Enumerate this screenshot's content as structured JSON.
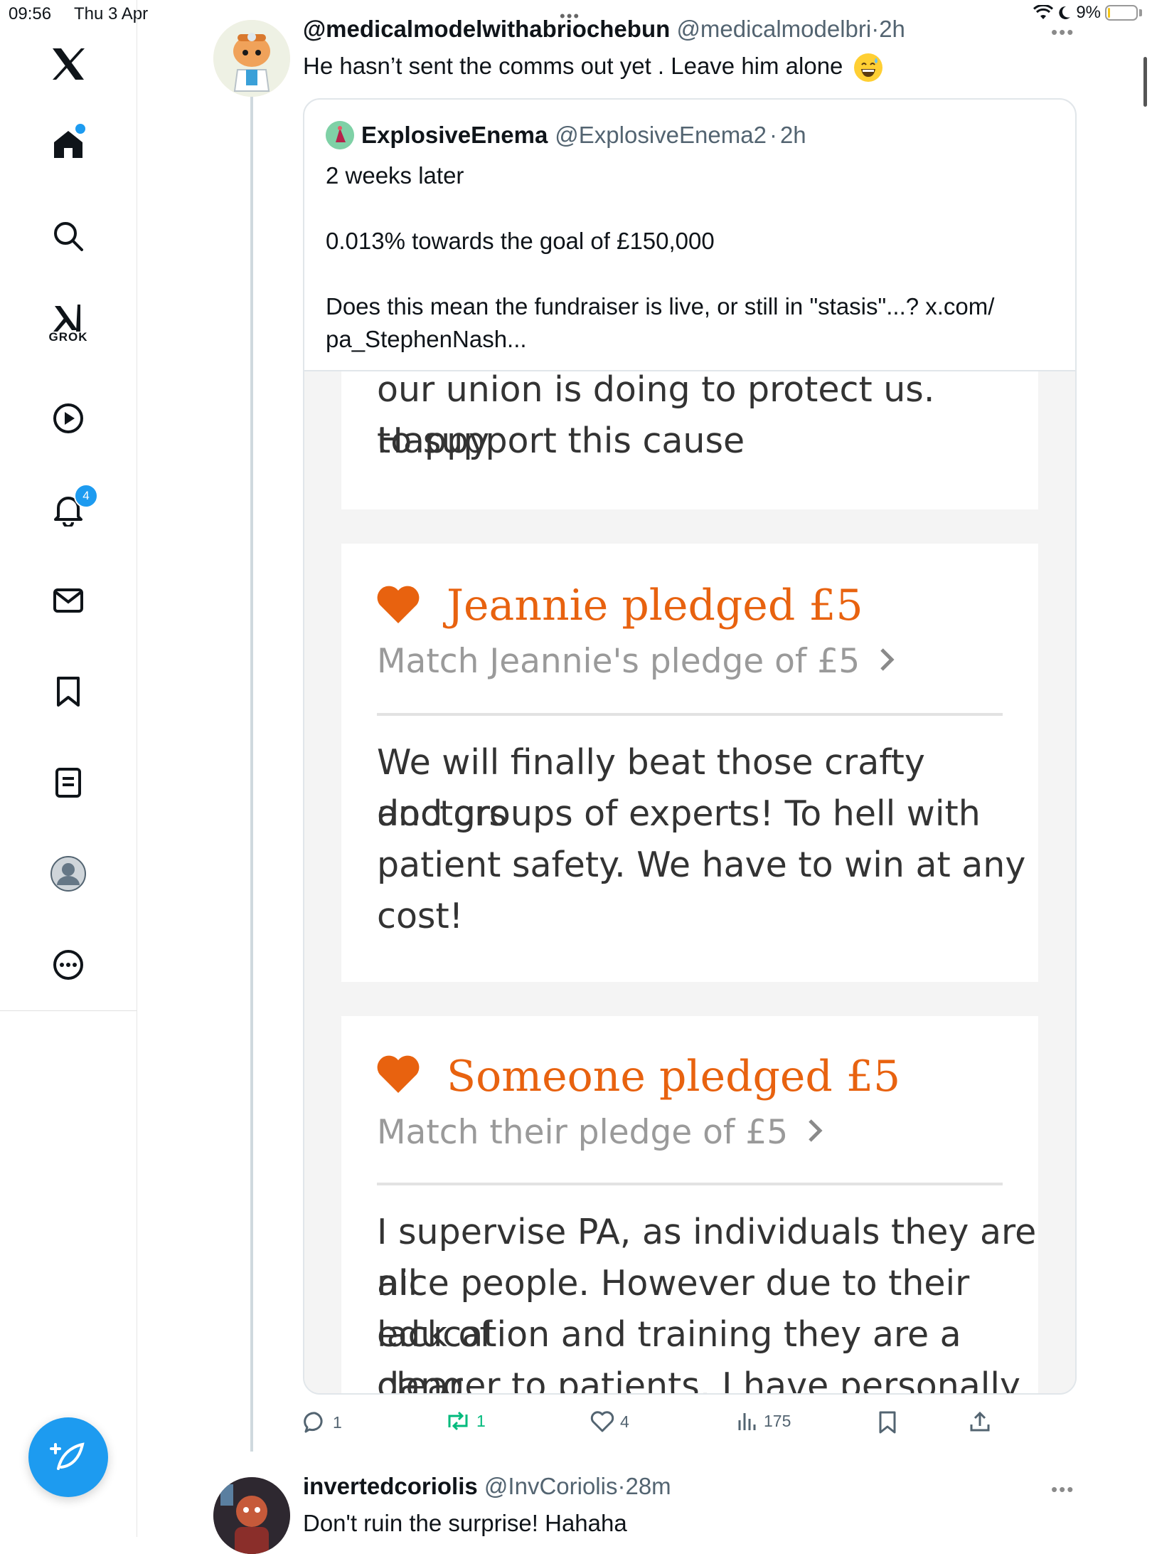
{
  "status_bar": {
    "time": "09:56",
    "date": "Thu 3 Apr",
    "battery": "9%",
    "battery_level": 0.09
  },
  "sidebar": {
    "grok_label": "GROK",
    "notifications_count": "4"
  },
  "tweet": {
    "display_name": "@medicalmodelwithabriochebun",
    "handle": "@medicalmodelbri",
    "time": "2h",
    "text": "He hasn’t sent the comms out yet . Leave him alone",
    "quote": {
      "display_name": "ExplosiveEnema",
      "handle": "@ExplosiveEnema2",
      "time": "2h",
      "line1": "2 weeks later",
      "line2": "0.013% towards the goal of £150,000",
      "line3a": "Does this mean the fundraiser is live, or still in \"stasis\"...? x.com/",
      "line3b": "pa_StephenNash...",
      "image": {
        "card1_line1": "our union is doing to protect us. Happy",
        "card1_line2": "to support this cause",
        "card2_title": "Jeannie pledged £5",
        "card2_match": "Match Jeannie's pledge of £5",
        "card2_line1": "We will finally beat those crafty doctors",
        "card2_line2": "and groups of experts! To hell with",
        "card2_line3": "patient safety. We have to win at any",
        "card2_line4": "cost!",
        "card3_title": "Someone pledged £5",
        "card3_match": "Match their pledge of £5",
        "card3_line1": "I supervise PA, as individuals they are all",
        "card3_line2": "nice people. However due to their lack of",
        "card3_line3": "education and training they are a clear",
        "card3_line4": "danger to patients. I have personally"
      }
    },
    "actions": {
      "replies": "1",
      "reposts": "1",
      "likes": "4",
      "views": "175"
    }
  },
  "tweet2": {
    "display_name": "invertedcoriolis",
    "handle": "@InvCoriolis",
    "time": "28m",
    "text": "Don't ruin the surprise! Hahaha"
  },
  "colors": {
    "accent": "#1d9bf0",
    "pledge_orange": "#e8620f",
    "repost_green": "#00ba7c"
  }
}
